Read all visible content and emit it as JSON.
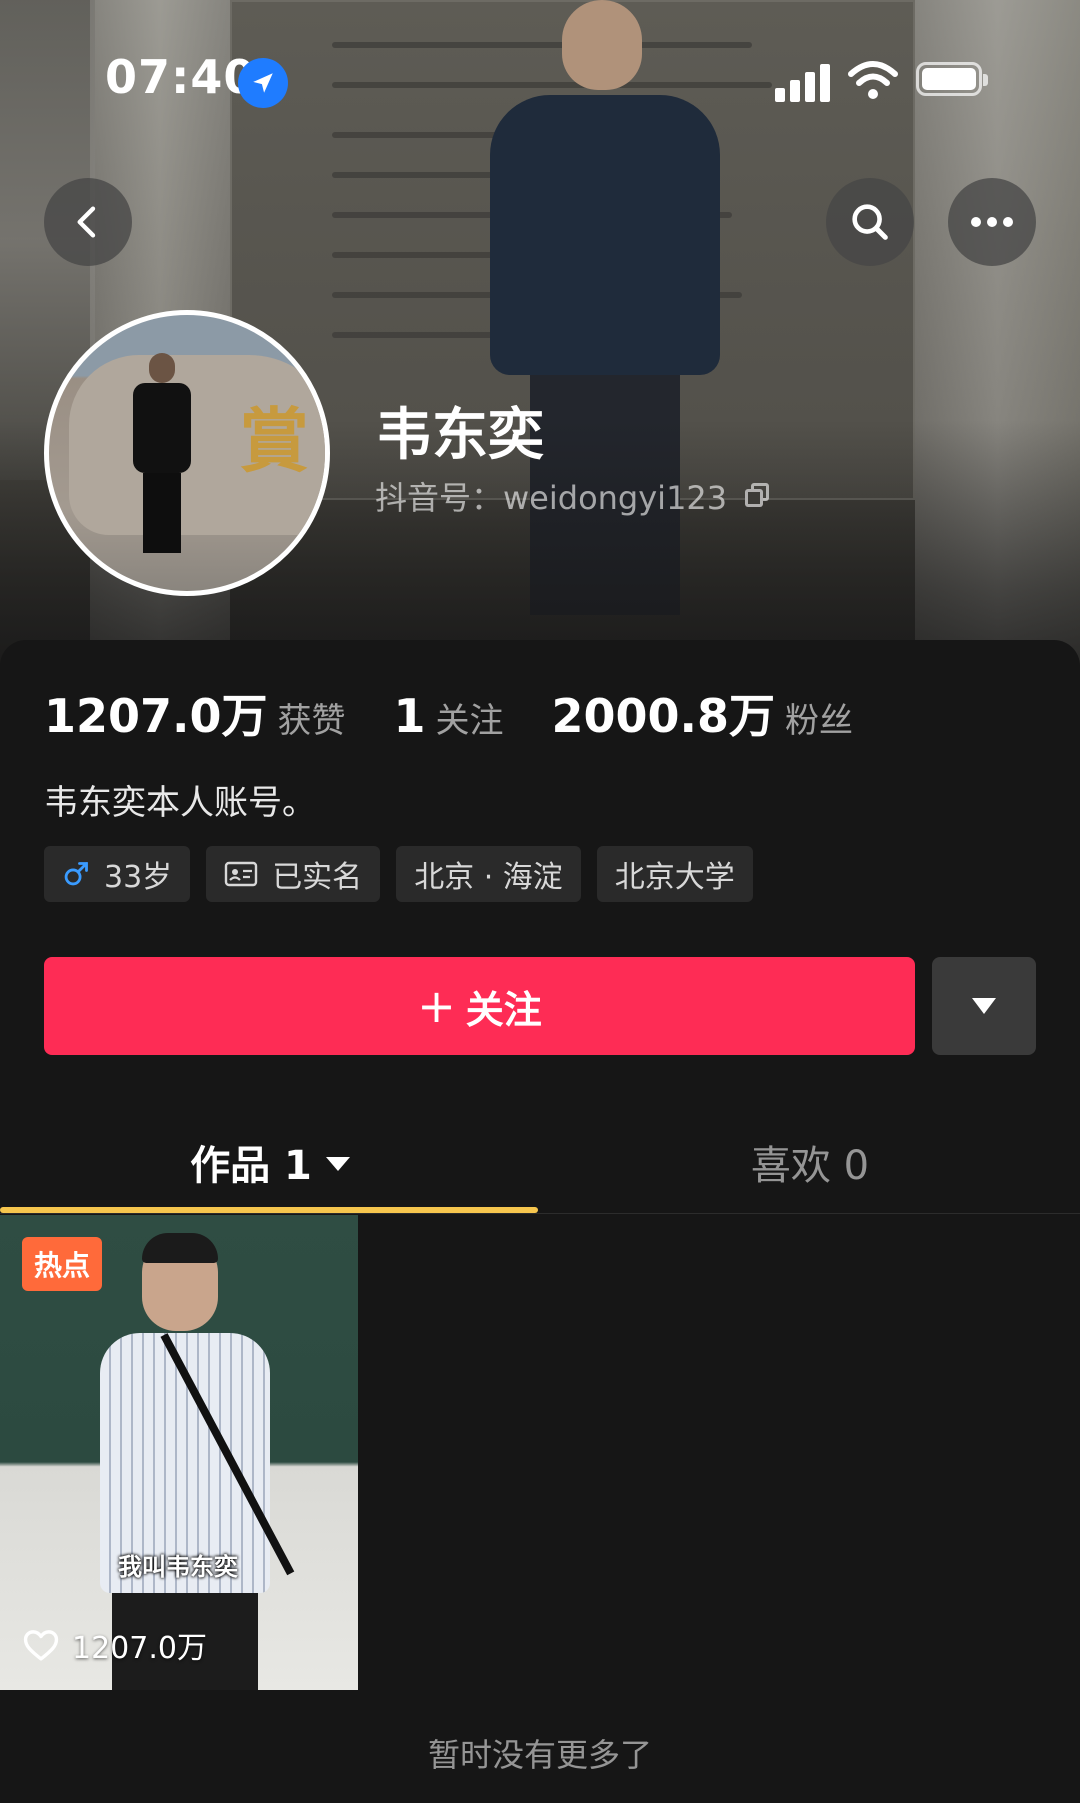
{
  "status_bar": {
    "time": "07:40"
  },
  "profile": {
    "name": "韦东奕",
    "douyin_id": "抖音号：weidongyi123"
  },
  "stats": [
    {
      "value": "1207.0万",
      "label": "获赞"
    },
    {
      "value": "1",
      "label": "关注"
    },
    {
      "value": "2000.8万",
      "label": "粉丝"
    }
  ],
  "bio": "韦东奕本人账号。",
  "tags": [
    {
      "icon": "male-icon",
      "label": "33岁"
    },
    {
      "icon": "id-card-icon",
      "label": "已实名"
    },
    {
      "icon": "",
      "label": "北京 · 海淀"
    },
    {
      "icon": "",
      "label": "北京大学"
    }
  ],
  "actions": {
    "follow_label": "关注"
  },
  "tabs": {
    "works_label": "作品 1",
    "likes_label": "喜欢 0"
  },
  "video": {
    "badge": "热点",
    "caption": "我叫韦东奕",
    "likes": "1207.0万"
  },
  "footer": {
    "no_more": "暂时没有更多了"
  },
  "colors": {
    "accent": "#fe2c55",
    "tab_indicator": "#f6c64e",
    "hot_badge": "#ff6a3a",
    "male_icon": "#3a9bff",
    "background": "#161616"
  }
}
